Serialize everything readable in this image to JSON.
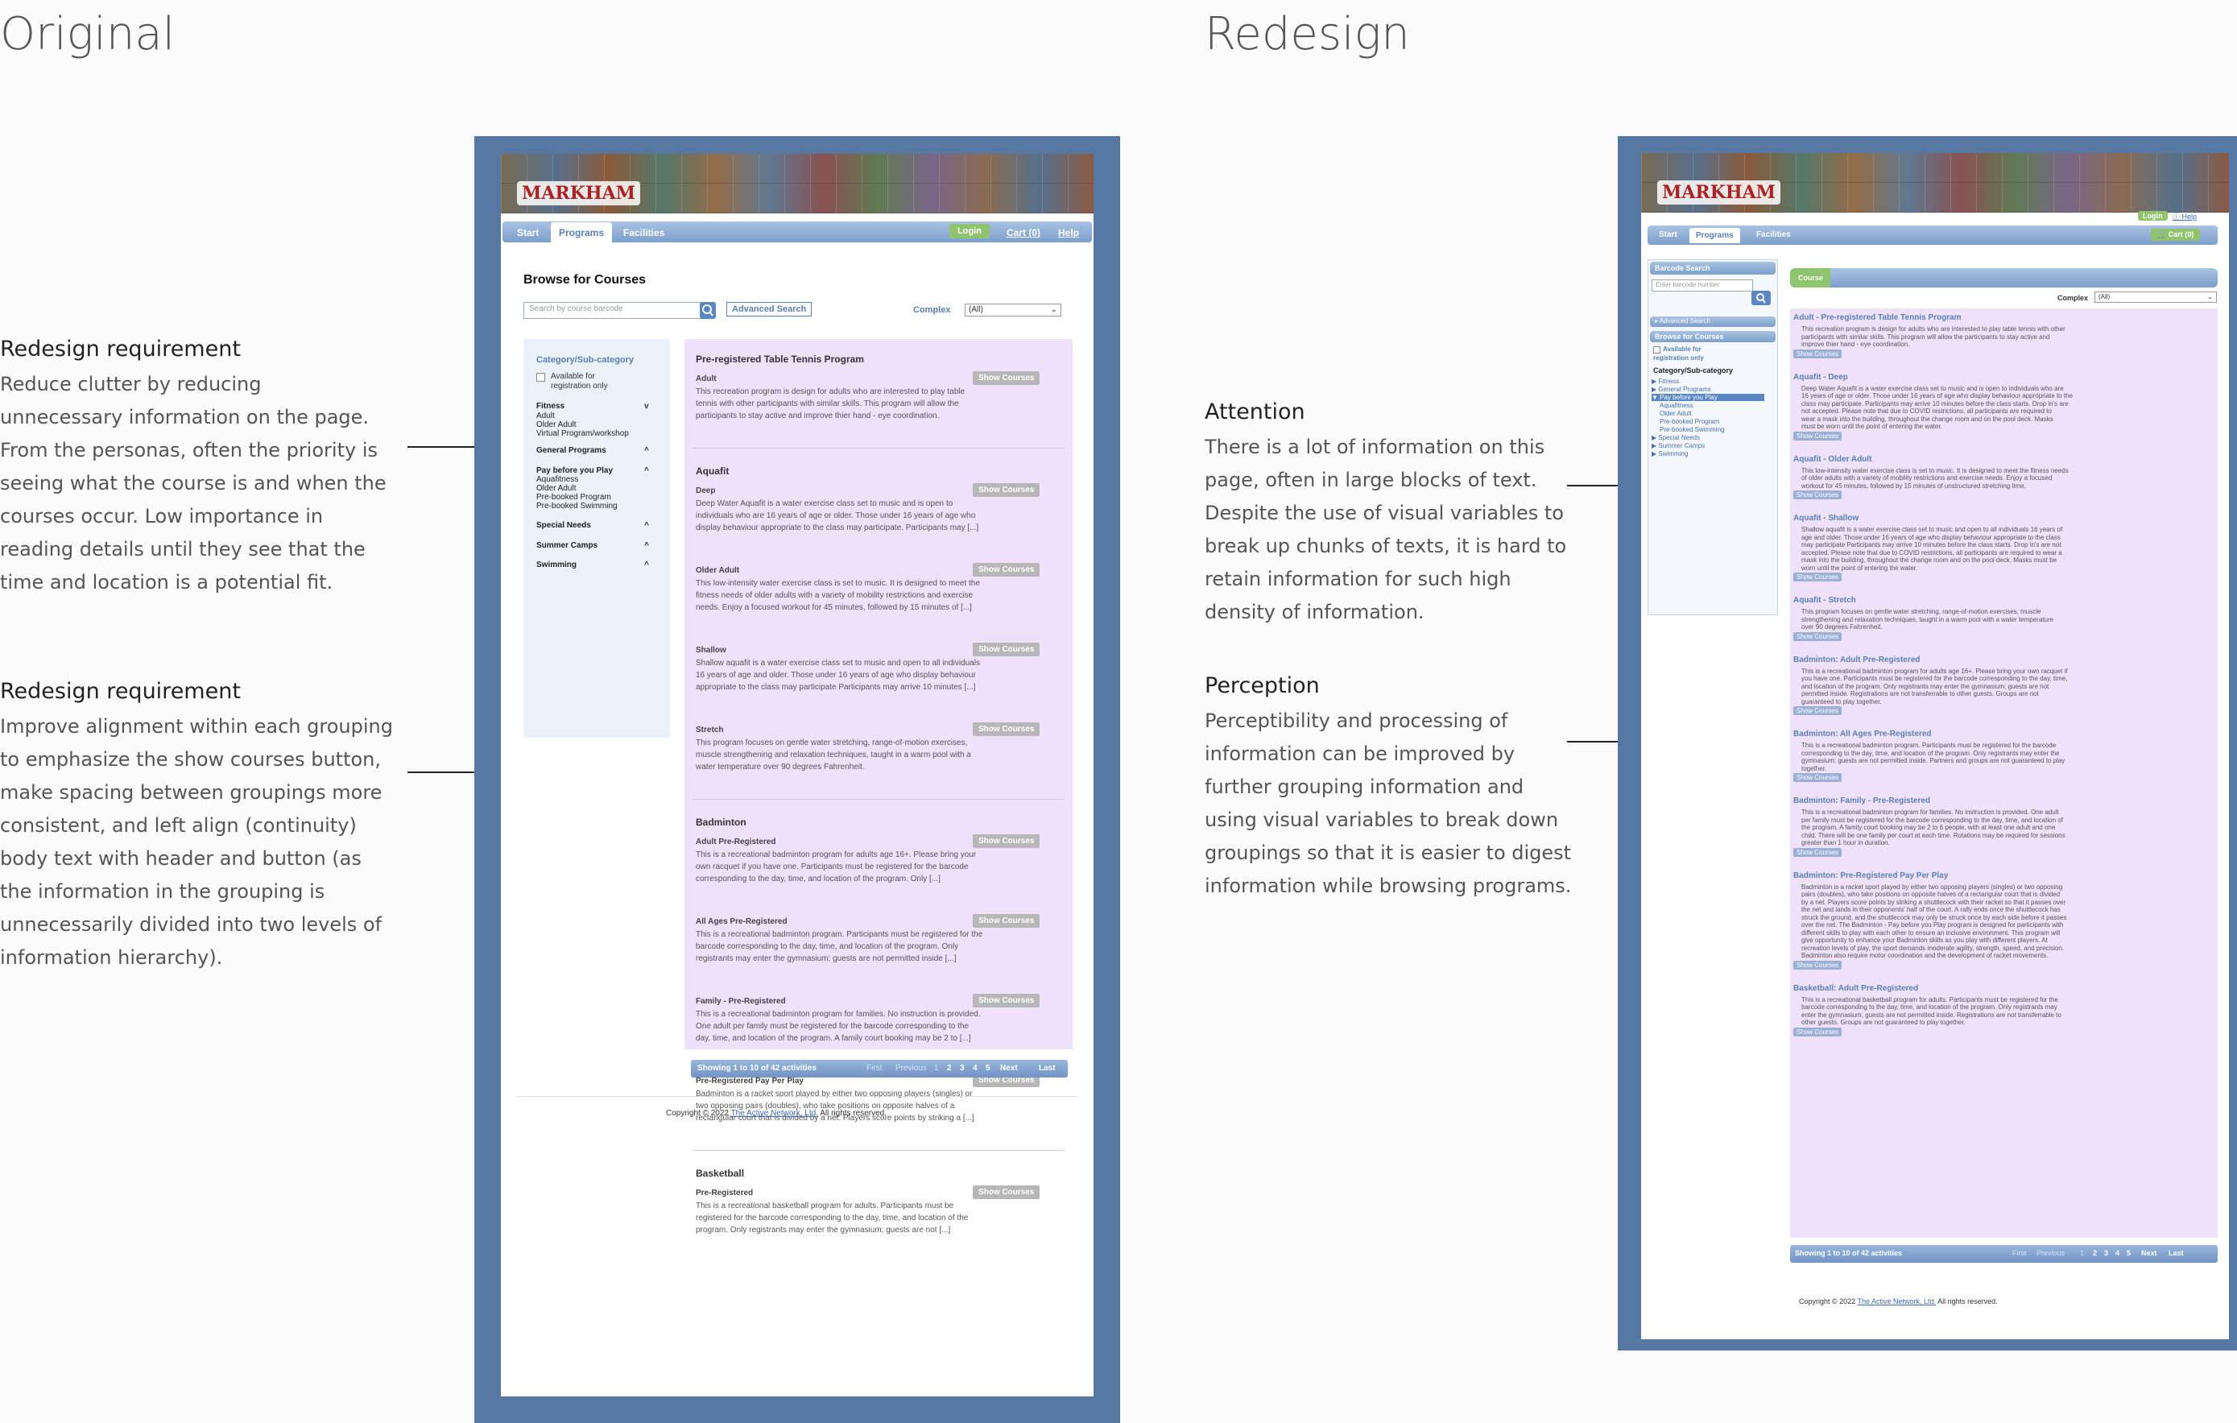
{
  "headings": {
    "left": "Original",
    "right": "Redesign"
  },
  "notes": [
    {
      "title": "Redesign requirement",
      "lines": [
        "Reduce clutter by reducing",
        "unnecessary information on the page.",
        "From the personas, often the priority is",
        "seeing what the course is and when the",
        "courses occur. Low importance in",
        "reading details until they see that the",
        "time and location is a potential fit."
      ]
    },
    {
      "title": "Redesign requirement",
      "lines": [
        "Improve alignment within each grouping",
        "to emphasize the show courses button,",
        "make spacing between groupings more",
        "consistent, and left align (continuity)",
        "body text with header and button (as",
        "the information in the grouping is",
        "unnecessarily divided into two levels of",
        "information hierarchy)."
      ]
    },
    {
      "title": "Attention",
      "lines": [
        "There is a lot of information on this",
        "page, often in large blocks of text.",
        "Despite the use of visual variables to",
        "break up chunks of texts, it is hard to",
        "retain information for such high",
        "density of information."
      ]
    },
    {
      "title": "Perception",
      "lines": [
        "Perceptibility and processing of",
        "information can be improved by",
        "further grouping information and",
        "using visual variables to break down",
        "groupings so that it is easier to digest",
        "information while browsing programs."
      ]
    }
  ],
  "orig": {
    "logo": "MARKHAM",
    "nav": {
      "start": "Start",
      "programs": "Programs",
      "facilities": "Facilities",
      "login": "Login",
      "cart": "Cart (0)",
      "help": "Help"
    },
    "browse_title": "Browse for Courses",
    "search_placeholder": "Search by course barcode",
    "advanced": "Advanced Search",
    "complex_label": "Complex",
    "complex_value": "(All)",
    "sidebar": {
      "title": "Category/Sub-category",
      "available": "Available for",
      "available2": "registration only",
      "groups": [
        {
          "label": "Fitness",
          "arrow": "v"
        },
        {
          "label": "Adult"
        },
        {
          "label": "Older Adult"
        },
        {
          "label": "Virtual Program/workshop"
        },
        {
          "label": "General Programs",
          "arrow": "^"
        },
        {
          "label": "Pay before you Play",
          "arrow": "^"
        },
        {
          "label": "Aquafitness"
        },
        {
          "label": "Older Adult"
        },
        {
          "label": "Pre-booked Program"
        },
        {
          "label": "Pre-booked Swimming"
        },
        {
          "label": "Special Needs",
          "arrow": "^"
        },
        {
          "label": "Summer Camps",
          "arrow": "^"
        },
        {
          "label": "Swimming",
          "arrow": "^"
        }
      ]
    },
    "show_label": "Show Courses",
    "groups": [
      {
        "heading": "Pre-registered Table Tennis Program",
        "items": [
          {
            "sub": "Adult",
            "desc": [
              "This recreation program is design for adults who are interested to play table",
              "tennis with other participants with similar skills. This program will allow the",
              "participants to stay active and improve thier hand - eye coordination."
            ]
          }
        ]
      },
      {
        "heading": "Aquafit",
        "items": [
          {
            "sub": "Deep",
            "desc": [
              "Deep Water Aquafit is a water exercise class set to music and is open to",
              "individuals who are 16 years of age or older. Those under 16 years of age who",
              "display behaviour appropriate to the class may participate. Participants may [...]"
            ]
          },
          {
            "sub": "Older Adult",
            "desc": [
              "This low-intensity water exercise class is set to music. It is designed to meet the",
              "fitness needs of older adults with a variety of mobility restrictions and exercise",
              "needs. Enjoy a focused workout for 45 minutes, followed by 15 minutes of [...]"
            ]
          },
          {
            "sub": "Shallow",
            "desc": [
              "Shallow aquafit is a water exercise class set to music and open to all individuals",
              "16 years of age and older. Those under 16 years of age who display behaviour",
              "appropriate to the class may participate Participants may arrive 10 minutes [...]"
            ]
          },
          {
            "sub": "Stretch",
            "desc": [
              "This program focuses on gentle water stretching, range-of-motion exercises,",
              "muscle strengthening and relaxation techniques, taught in a warm pool with a",
              "water temperature over 90 degrees Fahrenheit."
            ]
          }
        ]
      },
      {
        "heading": "Badminton",
        "items": [
          {
            "sub": "Adult Pre-Registered",
            "desc": [
              "This is a recreational badminton program for adults age 16+. Please bring your",
              "own racquet if you have one. Participants must be registered for the barcode",
              "corresponding to the day, time, and location of the program. Only [...]"
            ]
          },
          {
            "sub": "All Ages Pre-Registered",
            "desc": [
              "This is a recreational badminton program. Participants must be registered for the",
              "barcode corresponding to the day, time, and location of the program. Only",
              "registrants may enter the gymnasium; guests are not permitted inside [...]"
            ]
          },
          {
            "sub": "Family - Pre-Registered",
            "desc": [
              "This is a recreational badminton program for families. No instruction is provided.",
              "One adult per family must be registered for the barcode corresponding to the",
              "day, time, and location of the program. A family court booking may be 2 to [...]"
            ]
          },
          {
            "sub": "Pre-Registered Pay Per Play",
            "desc": [
              "Badminton is a racket sport played by either two opposing players (singles) or",
              "two opposing pairs (doubles), who take positions on opposite halves of a",
              "rectangular court that is divided by a net. Players score points by striking a [...]"
            ]
          }
        ]
      },
      {
        "heading": "Basketball",
        "items": [
          {
            "sub": "Pre-Registered",
            "desc": [
              "This is a recreational basketball program for adults. Participants must be",
              "registered for the barcode corresponding to the day, time, and location of the",
              "program. Only registrants may enter the gymnasium; guests are not [...]"
            ]
          }
        ]
      }
    ],
    "pager": {
      "showing": "Showing 1 to 10 of 42 activities",
      "first": "First",
      "previous": "Previous",
      "pages": [
        "1",
        "2",
        "3",
        "4",
        "5"
      ],
      "next": "Next",
      "last": "Last"
    },
    "footer": {
      "pre": "Copyright © 2022 ",
      "link": "The Active Network, Ltd.",
      "post": " All rights reserved."
    }
  },
  "redesign": {
    "logo": "MARKHAM",
    "login": "Login",
    "help": "Help",
    "nav": {
      "start": "Start",
      "programs": "Programs",
      "facilities": "Facilities",
      "cart": "Cart (0)"
    },
    "barcode_title": "Barcode Search",
    "barcode_placeholder": "Enter barcode number",
    "advanced": "Advanced Search",
    "browse_title": "Browse for Courses",
    "available": "Available for",
    "available2": "registration only",
    "cat_title": "Category/Sub-category",
    "tree": [
      {
        "label": "Fitness",
        "mark": "▶"
      },
      {
        "label": "General Programs",
        "mark": "▶"
      },
      {
        "label": "Pay before you Play",
        "mark": "▼",
        "selected": true
      },
      {
        "label": "Aquafitness",
        "mark": ""
      },
      {
        "label": "Older Adult",
        "mark": ""
      },
      {
        "label": "Pre-booked Program",
        "mark": ""
      },
      {
        "label": "Pre-booked Swimming",
        "mark": ""
      },
      {
        "label": "Special Needs",
        "mark": "▶"
      },
      {
        "label": "Summer Camps",
        "mark": "▶"
      },
      {
        "label": "Swimming",
        "mark": "▶"
      }
    ],
    "course_tab": "Course",
    "complex_label": "Complex",
    "complex_value": "(All)",
    "show_label": "Show Courses",
    "items": [
      {
        "title": "Adult - Pre-registered Table Tennis Program",
        "desc": [
          "This recreation program is design for adults who are interested to play table tennis with other",
          "participants with similar skills. This program will allow the participants to stay active and",
          "improve thier hand - eye coordination."
        ]
      },
      {
        "title": "Aquafit - Deep",
        "desc": [
          "Deep Water Aquafit is a water exercise class set to music and is open to individuals who are",
          "16 years of age or older. Those under 16 years of age who display behaviour appropriate to the",
          "class may participate. Participants may arrive 10 minutes before the class starts. Drop in's are",
          "not accepted. Please note that due to COVID restrictions, all participants are required to",
          "wear a mask into the building, throughout the change room and on the pool deck. Masks",
          "must be worn until the point of entering the water."
        ]
      },
      {
        "title": "Aquafit - Older Adult",
        "desc": [
          "This low-intensity water exercise class is set to music. It is designed to meet the fitness needs",
          "of older adults with a variety of mobility restrictions and exercise needs. Enjoy a focused",
          "workout for 45 minutes, followed by 15 minutes of unstructured stretching time."
        ]
      },
      {
        "title": "Aquafit - Shallow",
        "desc": [
          "Shallow aquafit is a water exercise class set to music and open to all individuals 16 years of",
          "age and older. Those under 16 years of age who display behaviour appropriate to the class",
          "may participate Participants may arrive 10 minutes before the class starts. Drop in's are not",
          "accepted. Please note that due to COVID restrictions, all participants are required to wear a",
          "mask into the building, throughout the change room and on the pool deck. Masks must be",
          "worn until the point of entering the water."
        ]
      },
      {
        "title": "Aquafit - Stretch",
        "desc": [
          "This program focuses on gentle water stretching, range-of-motion exercises, muscle",
          "strengthening and relaxation techniques, taught in a warm pool with a water temperature",
          "over 90 degrees Fahrenheit."
        ]
      },
      {
        "title": "Badminton: Adult Pre-Registered",
        "desc": [
          "This is a recreational badminton program for adults age 16+. Please bring your own racquet if",
          "you have one. Participants must be registered for the barcode corresponding to the day, time,",
          "and location of the program. Only registrants may enter the gymnasium; guests are not",
          "permitted inside. Registrations are not transferrable to other guests. Groups are not",
          "guaranteed to play together."
        ]
      },
      {
        "title": "Badminton: All Ages Pre-Registered",
        "desc": [
          "This is a recreational badminton program. Participants must be registered for the barcode",
          "corresponding to the day, time, and location of the program. Only registrants may enter the",
          "gymnasium; guests are not permitted inside. Partners and groups are not guaranteed to play",
          "together."
        ]
      },
      {
        "title": "Badminton: Family - Pre-Registered",
        "desc": [
          "This is a recreational badminton program for families. No instruction is provided. One adult",
          "per family must be registered for the barcode corresponding to the day, time, and location of",
          "the program. A family court booking may be 2 to 6 people, with at least one adult and one",
          "child. There will be one family per court at each time. Rotations may be required for sessions",
          "greater than 1 hour in duration."
        ]
      },
      {
        "title": "Badminton: Pre-Registered Pay Per Play",
        "desc": [
          "Badminton is a racket sport played by either two opposing players (singles) or two opposing",
          "pairs (doubles), who take positions on opposite halves of a rectangular court that is divided",
          "by a net. Players score points by striking a shuttlecock with their racket so that it passes over",
          "the net and lands in their opponents' half of the court. A rally ends once the shuttlecock has",
          "struck the ground, and the shuttlecock may only be struck once by each side before it passes",
          "over the net. The Badminton - Pay before you Play program is designed for participants with",
          "different skills to play with each other to ensure an inclusive environment. This program will",
          "give opportunity to enhance your Badminton skills as you play with different players. At",
          "recreation levels of play, the sport demands moderate agility, strength, speed, and precision.",
          "Badminton also require motor coordination and the development of racket movements."
        ]
      },
      {
        "title": "Basketball: Adult Pre-Registered",
        "desc": [
          "This is a recreational basketball program for adults. Participants must be registered for the",
          "barcode corresponding to the day, time, and location of the program. Only registrants may",
          "enter the gymnasium; guests are not permitted inside. Registrations are not transferrable to",
          "other guests. Groups are not guaranteed to play together."
        ]
      }
    ],
    "pager": {
      "showing": "Showing 1 to 10 of 42 activities",
      "first": "First",
      "previous": "Previous",
      "pages": [
        "1",
        "2",
        "3",
        "4",
        "5"
      ],
      "next": "Next",
      "last": "Last"
    },
    "footer": {
      "pre": "Copyright © 2022 ",
      "link": "The Active Network, Ltd.",
      "post": " All rights reserved."
    }
  }
}
